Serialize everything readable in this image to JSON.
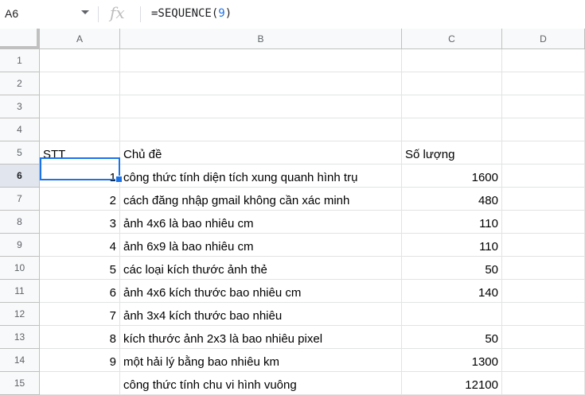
{
  "formula_bar": {
    "name_box": "A6",
    "fx_icon": "fx-icon",
    "formula_prefix": "=SEQUENCE(",
    "formula_arg": "9",
    "formula_suffix": ")"
  },
  "columns": [
    "A",
    "B",
    "C",
    "D"
  ],
  "rows": [
    {
      "n": "1",
      "a": "",
      "b": "",
      "c": ""
    },
    {
      "n": "2",
      "a": "",
      "b": "",
      "c": ""
    },
    {
      "n": "3",
      "a": "",
      "b": "",
      "c": ""
    },
    {
      "n": "4",
      "a": "",
      "b": "",
      "c": ""
    },
    {
      "n": "5",
      "a": "STT",
      "b": "Chủ đề",
      "c": "Số lượng"
    },
    {
      "n": "6",
      "a": "1",
      "b": "công thức tính diện tích xung quanh hình trụ",
      "c": "1600"
    },
    {
      "n": "7",
      "a": "2",
      "b": "cách đăng nhập gmail không cần xác minh",
      "c": "480"
    },
    {
      "n": "8",
      "a": "3",
      "b": "ảnh 4x6 là bao nhiêu cm",
      "c": "110"
    },
    {
      "n": "9",
      "a": "4",
      "b": "ảnh 6x9 là bao nhiêu cm",
      "c": "110"
    },
    {
      "n": "10",
      "a": "5",
      "b": "các loại kích thước ảnh thẻ",
      "c": "50"
    },
    {
      "n": "11",
      "a": "6",
      "b": "ảnh 4x6 kích thước bao nhiêu cm",
      "c": "140"
    },
    {
      "n": "12",
      "a": "7",
      "b": "ảnh 3x4 kích thước bao nhiêu",
      "c": ""
    },
    {
      "n": "13",
      "a": "8",
      "b": "kích thước ảnh 2x3 là bao nhiêu pixel",
      "c": "50"
    },
    {
      "n": "14",
      "a": "9",
      "b": "một hải lý bằng bao nhiêu km",
      "c": "1300"
    },
    {
      "n": "15",
      "a": "",
      "b": "công thức tính chu vi hình vuông",
      "c": "12100"
    }
  ],
  "selected_cell": "A6",
  "colors": {
    "selection": "#1a73e8",
    "header_bg": "#f8f9fa"
  }
}
